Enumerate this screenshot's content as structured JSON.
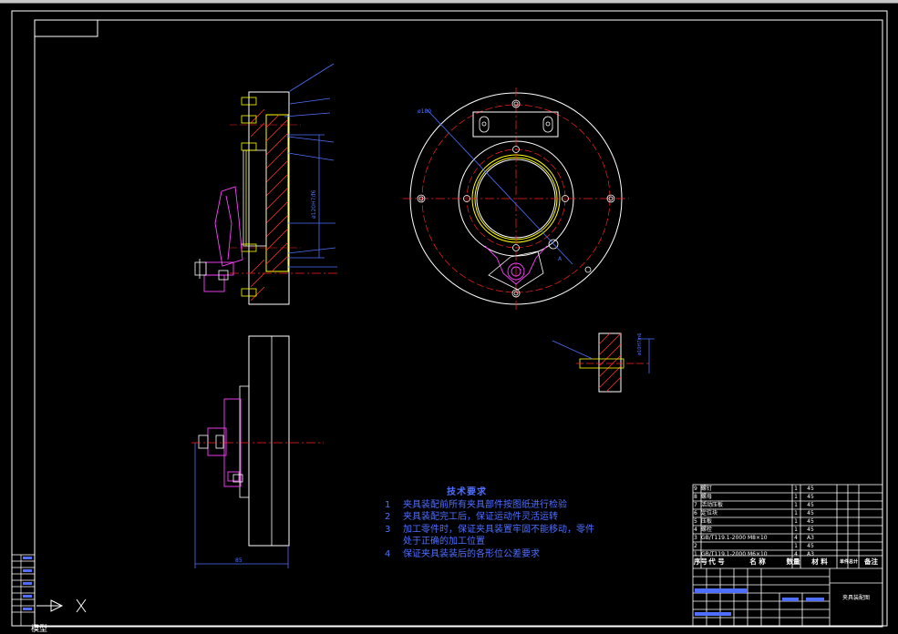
{
  "notes": {
    "title": "技术要求",
    "items": [
      {
        "num": "1",
        "text": "夹具装配前所有夹具部件按图纸进行检验"
      },
      {
        "num": "2",
        "text": "夹具装配完工后，保证运动件灵活运转"
      },
      {
        "num": "3",
        "text": "加工零件时，保证夹具装置牢固不能移动，零件"
      },
      {
        "num": "",
        "text": "处于正确的加工位置"
      },
      {
        "num": "4",
        "text": "保证夹具装装后的各形位公差要求"
      }
    ]
  },
  "bom": {
    "rows": [
      {
        "no": "9",
        "name": "螺钉",
        "qty": "1",
        "material": "45"
      },
      {
        "no": "8",
        "name": "螺母",
        "qty": "1",
        "material": "45"
      },
      {
        "no": "7",
        "name": "活动压板",
        "qty": "1",
        "material": "45"
      },
      {
        "no": "6",
        "name": "定位块",
        "qty": "1",
        "material": "45"
      },
      {
        "no": "5",
        "name": "压板",
        "qty": "1",
        "material": "45"
      },
      {
        "no": "4",
        "name": "螺栓",
        "qty": "1",
        "material": "45"
      },
      {
        "no": "3",
        "name": "GB/T119.1-2000 M8×10",
        "qty": "4",
        "material": "A3"
      },
      {
        "no": "2",
        "name": "",
        "qty": "1",
        "material": "45"
      },
      {
        "no": "1",
        "name": "GB/T119.1-2000 M6×10",
        "qty": "4",
        "material": "A3"
      }
    ],
    "header": [
      "序号",
      "代  号",
      "名  称",
      "数量",
      "材  料",
      "单件总计",
      "备注"
    ]
  },
  "assembly_label": "夹具装配图",
  "status_label": "模型",
  "colors": {
    "background": "#000000",
    "frame": "#ffffff",
    "part_yellow": "#ffff00",
    "centerline_red": "#ff2020",
    "hatch_red": "#ff3030",
    "magenta": "#ff40ff",
    "dimension_blue": "#4e6fff"
  }
}
